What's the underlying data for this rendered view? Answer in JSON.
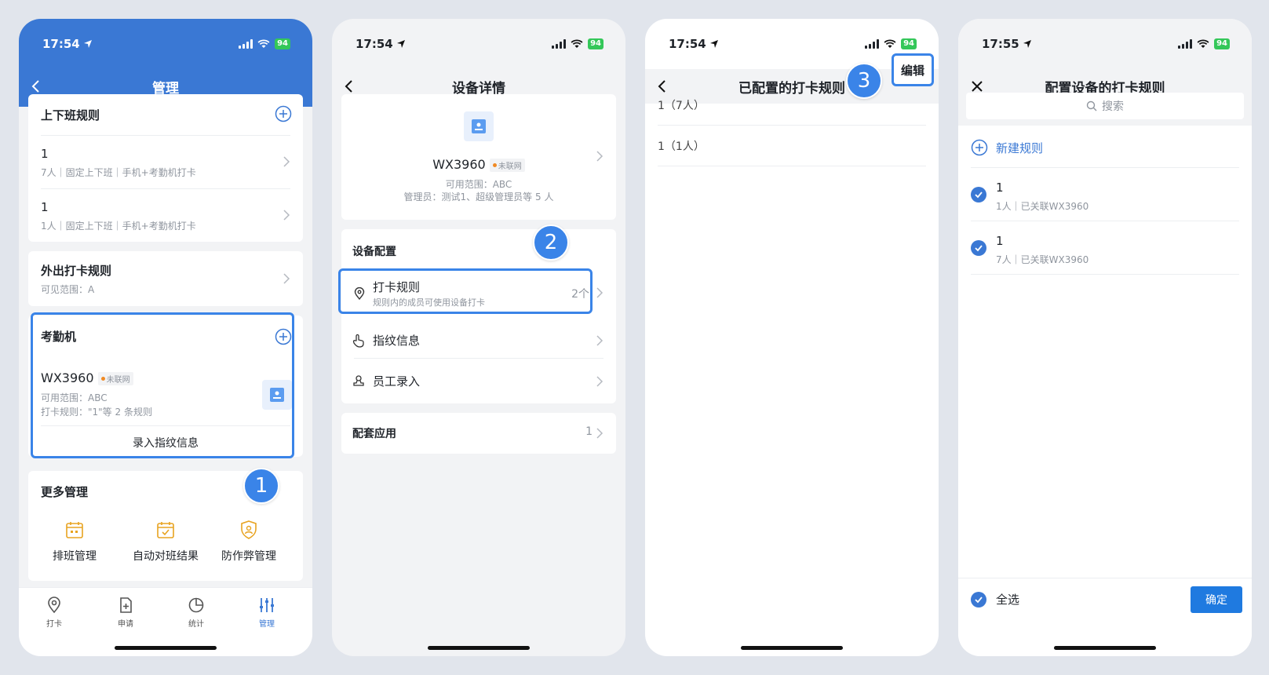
{
  "phone1": {
    "time": "17:54",
    "battery": "94",
    "title": "管理",
    "shift_rules": {
      "title": "上下班规则",
      "items": [
        {
          "name": "1",
          "desc": "7人｜固定上下班｜手机+考勤机打卡"
        },
        {
          "name": "1",
          "desc": "1人｜固定上下班｜手机+考勤机打卡"
        }
      ]
    },
    "outside_rules": {
      "title": "外出打卡规则",
      "desc": "可见范围：A"
    },
    "attendance_machine": {
      "title": "考勤机",
      "device_name": "WX3960",
      "status_tag": "未联网",
      "scope": "可用范围：ABC",
      "rules": "打卡规则：\"1\"等 2 条规则",
      "action": "录入指纹信息"
    },
    "more": {
      "title": "更多管理",
      "items": [
        "排班管理",
        "自动对班结果",
        "防作弊管理"
      ]
    },
    "tabs": [
      "打卡",
      "申请",
      "统计",
      "管理"
    ],
    "step": "1"
  },
  "phone2": {
    "time": "17:54",
    "battery": "94",
    "title": "设备详情",
    "device": {
      "name": "WX3960",
      "status_tag": "未联网",
      "scope": "可用范围：ABC",
      "admins": "管理员：测试1、超级管理员等 5 人"
    },
    "config_title": "设备配置",
    "punch_rule": {
      "title": "打卡规则",
      "desc": "规则内的成员可使用设备打卡",
      "count": "2个"
    },
    "fingerprint": "指纹信息",
    "employee_entry": "员工录入",
    "apps": {
      "title": "配套应用",
      "count": "1"
    },
    "step": "2"
  },
  "phone3": {
    "time": "17:54",
    "battery": "94",
    "title": "已配置的打卡规则",
    "edit": "编辑",
    "rules": [
      "1（7人）",
      "1（1人）"
    ],
    "step": "3"
  },
  "phone4": {
    "time": "17:55",
    "battery": "94",
    "title": "配置设备的打卡规则",
    "search_placeholder": "搜索",
    "new_rule": "新建规则",
    "rules": [
      {
        "name": "1",
        "desc": "1人｜已关联WX3960"
      },
      {
        "name": "1",
        "desc": "7人｜已关联WX3960"
      }
    ],
    "select_all": "全选",
    "confirm": "确定"
  },
  "colors": {
    "primary": "#3a78d4",
    "highlight": "#3a84e8",
    "warning": "#f08a24",
    "battery": "#34c759"
  }
}
